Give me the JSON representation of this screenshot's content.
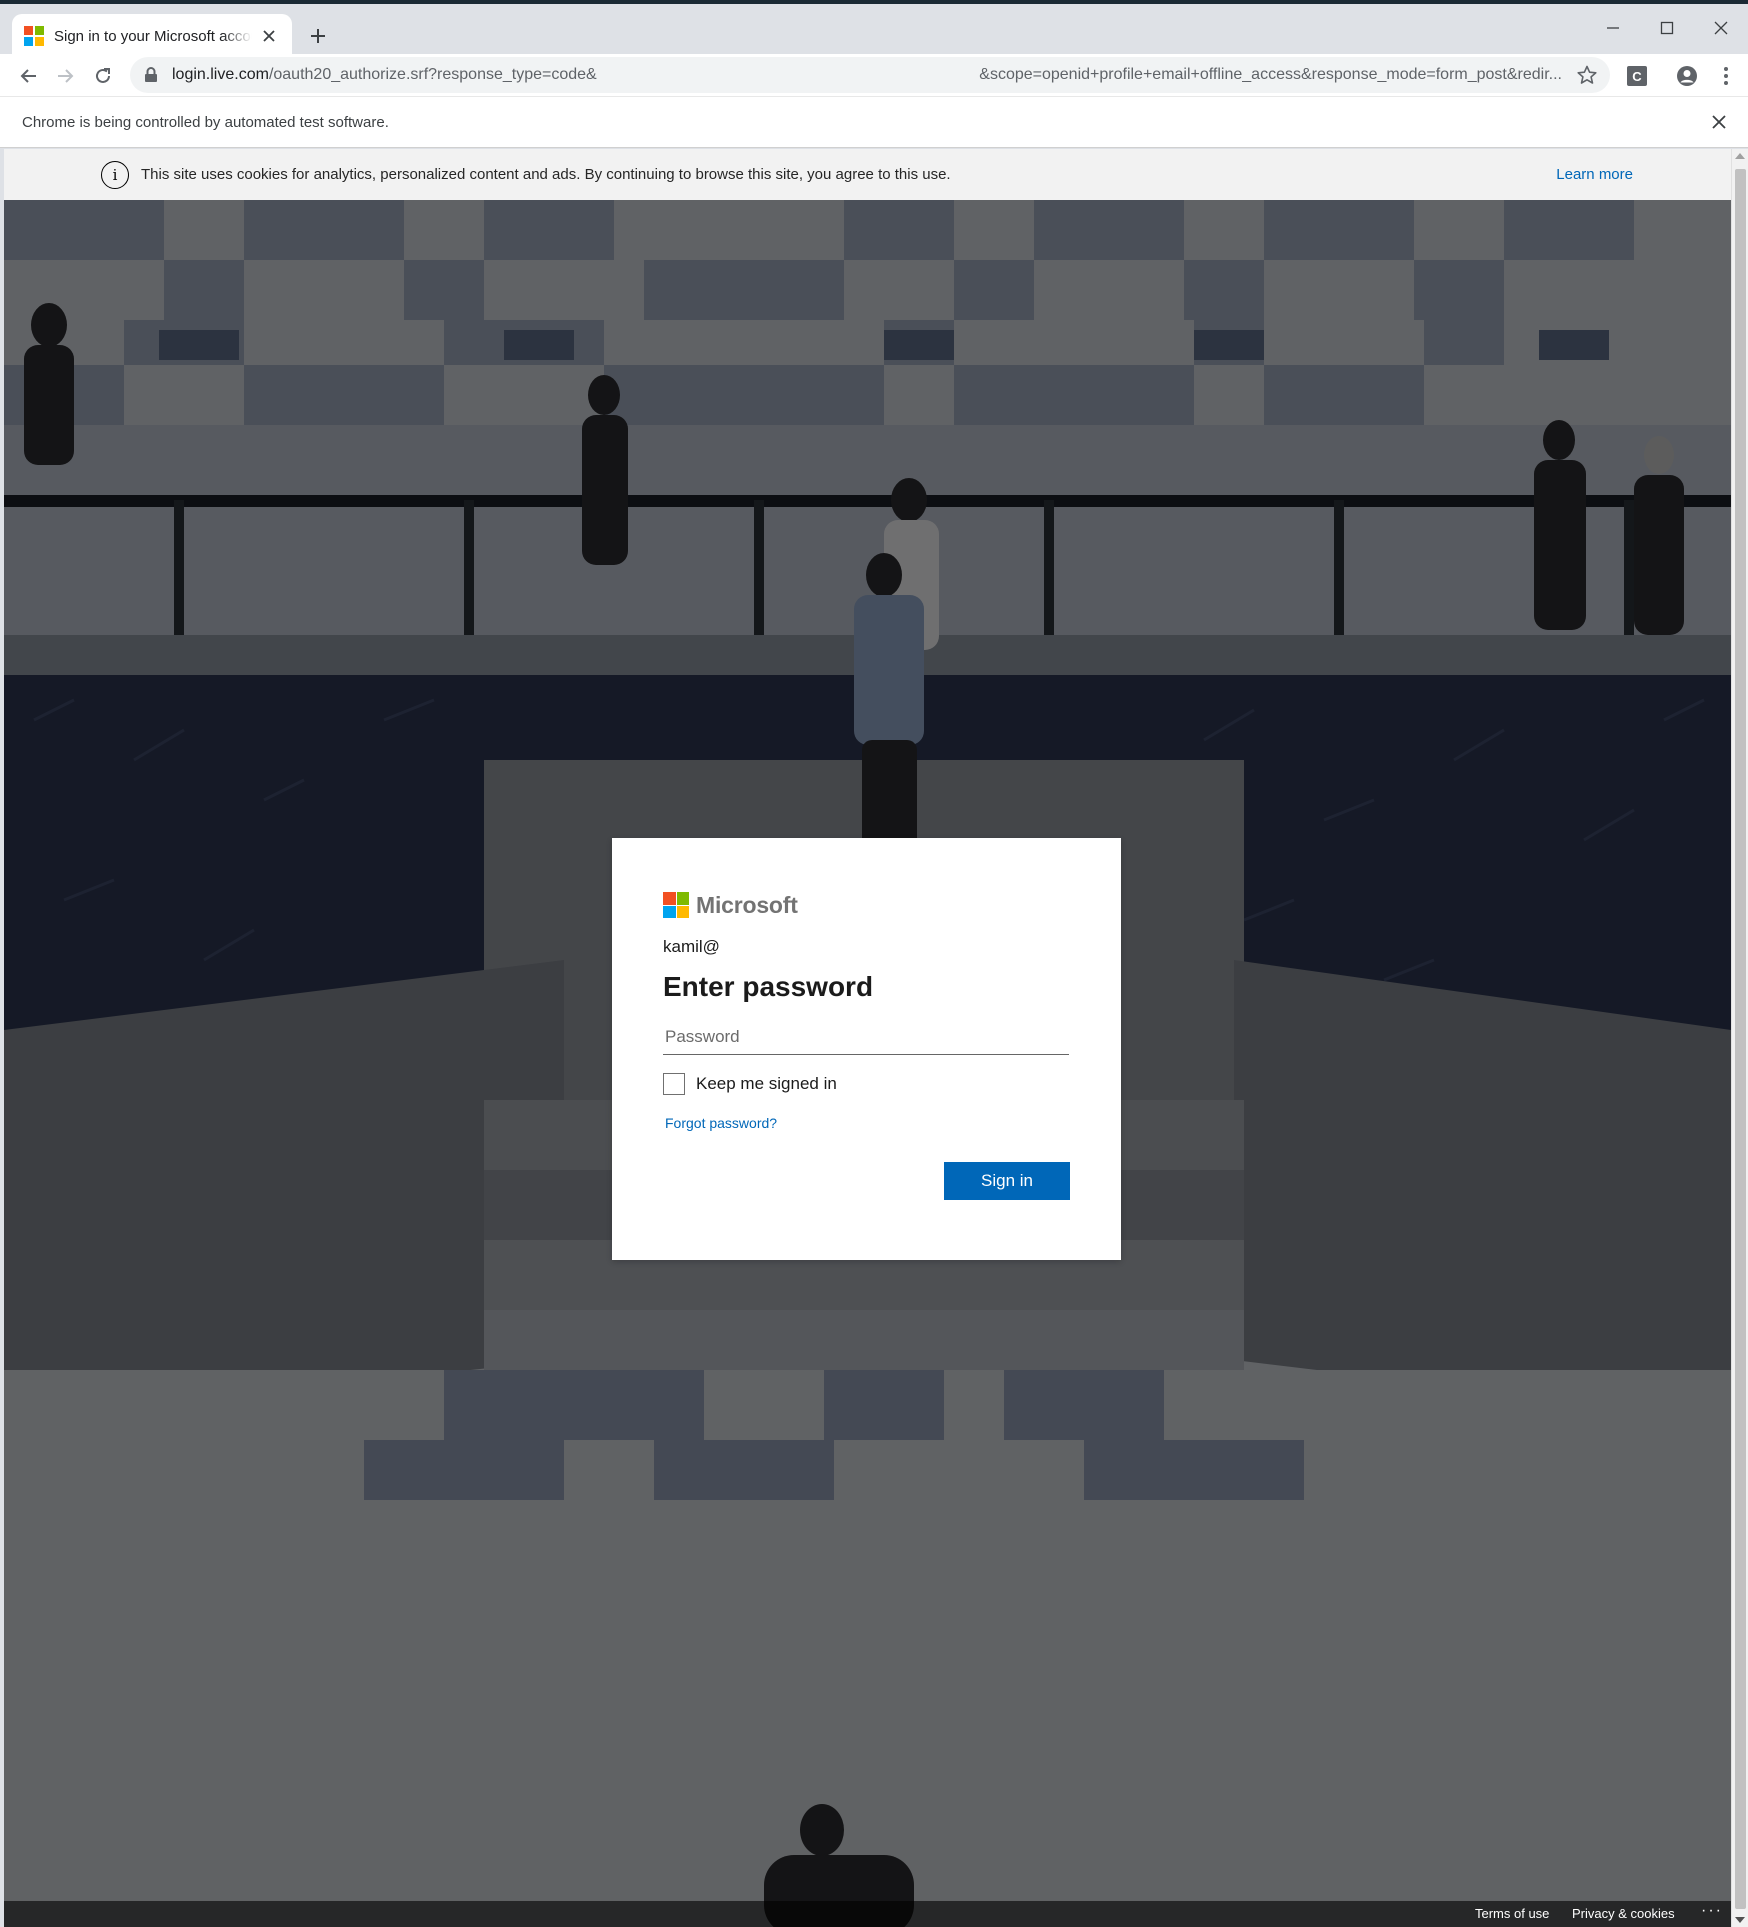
{
  "browser": {
    "tab_title": "Sign in to your Microsoft account",
    "url_host": "login.live.com",
    "url_path": "/oauth20_authorize.srf?response_type=code&",
    "url_tail": "&scope=openid+profile+email+offline_access&response_mode=form_post&redir...",
    "automation_notice": "Chrome is being controlled by automated test software.",
    "extension_label": "C"
  },
  "cookie_banner": {
    "text": "This site uses cookies for analytics, personalized content and ads. By continuing to browse this site, you agree to this use.",
    "learn_more": "Learn more"
  },
  "card": {
    "brand": "Microsoft",
    "identity": "kamil@",
    "heading": "Enter password",
    "password_placeholder": "Password",
    "keep_signed_in": "Keep me signed in",
    "keep_signed_in_checked": false,
    "forgot_link": "Forgot password?",
    "signin_label": "Sign in"
  },
  "footer": {
    "terms": "Terms of use",
    "privacy": "Privacy & cookies",
    "more": "···"
  },
  "colors": {
    "accent": "#0067b8",
    "ms_red": "#f25022",
    "ms_green": "#7fba00",
    "ms_blue": "#00a4ef",
    "ms_yellow": "#ffb900"
  }
}
